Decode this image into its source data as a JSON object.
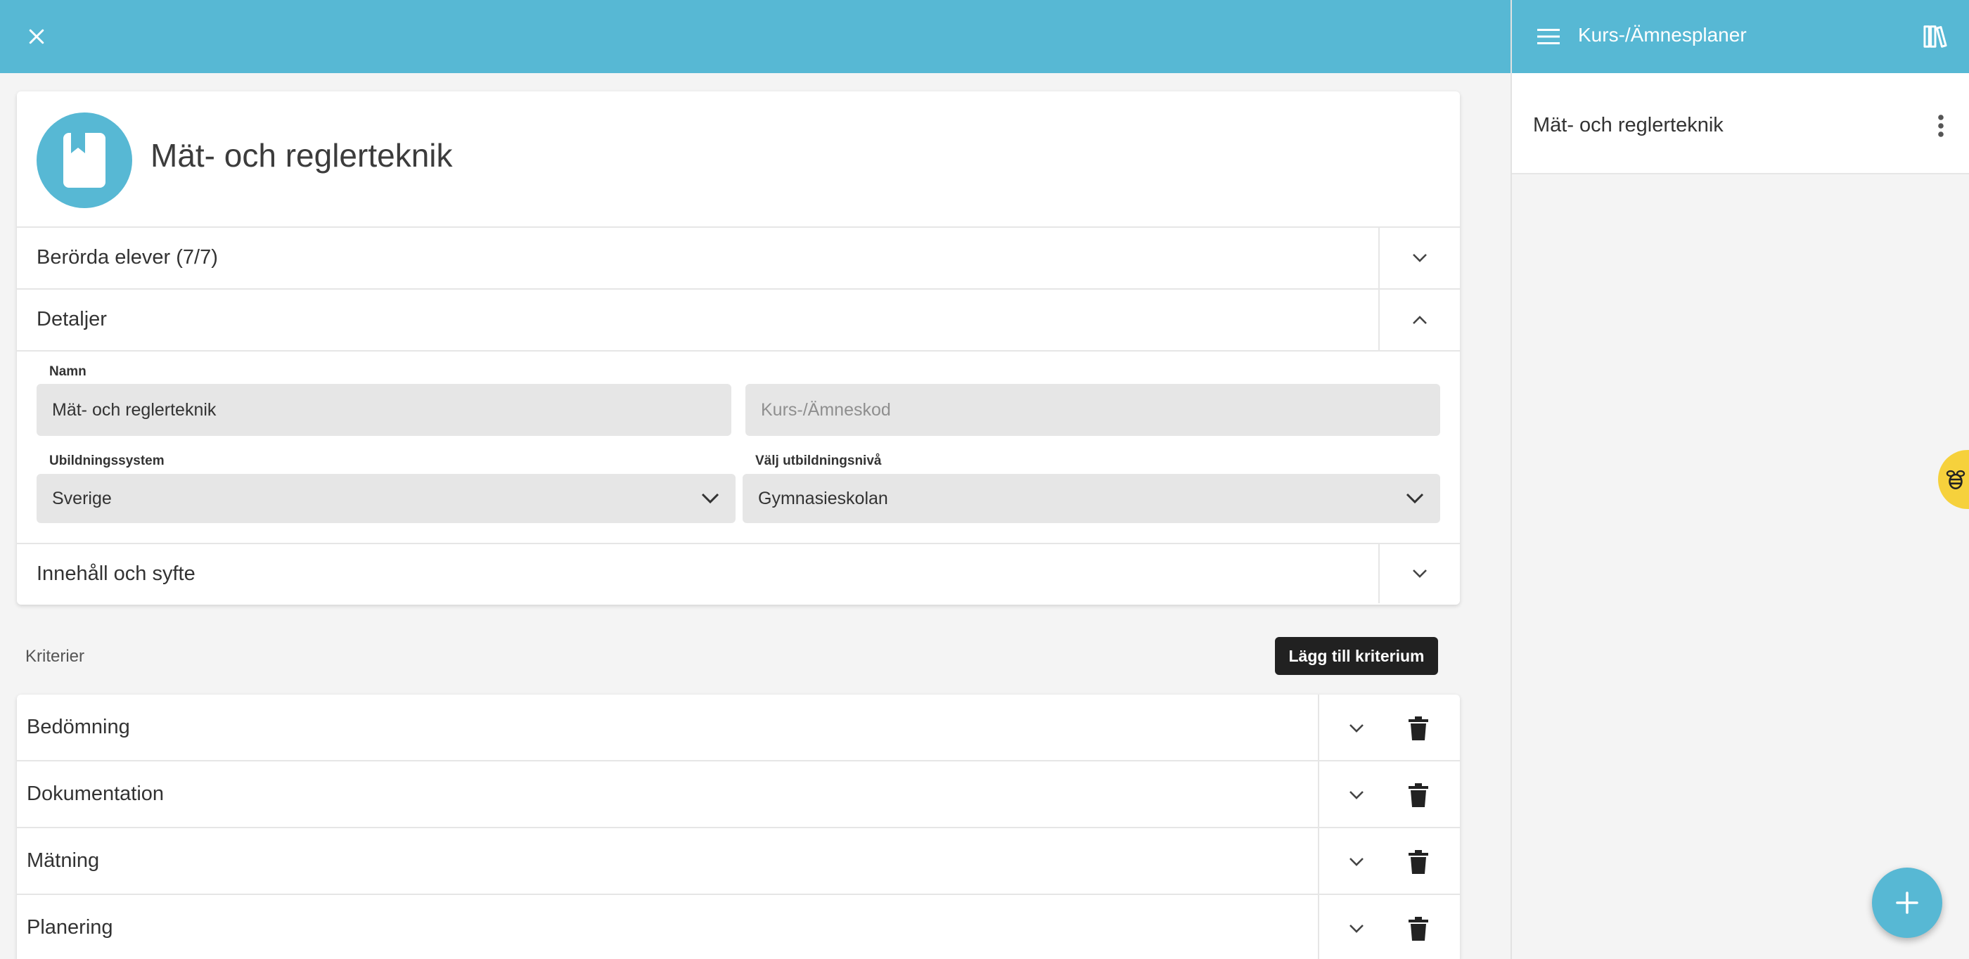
{
  "sidebar": {
    "title": "Kurs-/Ämnesplaner",
    "items": [
      {
        "label": "Mät- och reglerteknik"
      }
    ]
  },
  "card": {
    "title": "Mät- och reglerteknik",
    "sections": {
      "students": "Berörda elever (7/7)",
      "details": "Detaljer",
      "content": "Innehåll och syfte"
    },
    "fields": {
      "name_label": "Namn",
      "name_value": "Mät- och reglerteknik",
      "code_placeholder": "Kurs-/Ämneskod",
      "system_label": "Ubildningssystem",
      "system_value": "Sverige",
      "level_label": "Välj utbildningsnivå",
      "level_value": "Gymnasieskolan"
    }
  },
  "criteria": {
    "heading": "Kriterier",
    "add_button": "Lägg till kriterium",
    "items": [
      {
        "name": "Bedömning"
      },
      {
        "name": "Dokumentation"
      },
      {
        "name": "Mätning"
      },
      {
        "name": "Planering"
      }
    ]
  },
  "colors": {
    "accent": "#57b8d4",
    "dark_button": "#212121",
    "helper": "#f6d13c"
  },
  "icons": [
    "close-icon",
    "menu-icon",
    "library-icon",
    "more-vert-icon",
    "bookmark-book-icon",
    "chevron-down-icon",
    "chevron-up-icon",
    "trash-icon",
    "plus-icon",
    "bee-icon"
  ]
}
